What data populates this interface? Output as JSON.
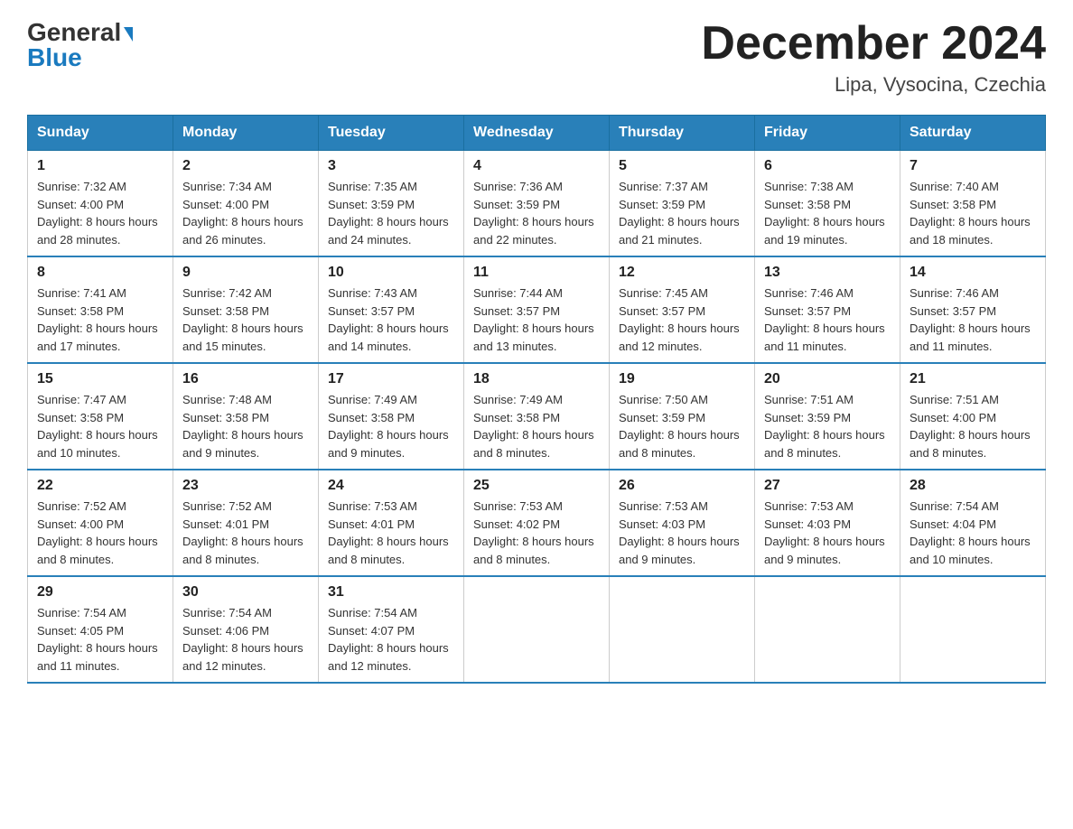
{
  "header": {
    "logo": {
      "general": "General",
      "blue": "Blue",
      "line1": "General",
      "line2": "Blue"
    },
    "title": "December 2024",
    "location": "Lipa, Vysocina, Czechia"
  },
  "calendar": {
    "headers": [
      "Sunday",
      "Monday",
      "Tuesday",
      "Wednesday",
      "Thursday",
      "Friday",
      "Saturday"
    ],
    "weeks": [
      [
        {
          "day": "1",
          "sunrise": "7:32 AM",
          "sunset": "4:00 PM",
          "daylight": "8 hours and 28 minutes."
        },
        {
          "day": "2",
          "sunrise": "7:34 AM",
          "sunset": "4:00 PM",
          "daylight": "8 hours and 26 minutes."
        },
        {
          "day": "3",
          "sunrise": "7:35 AM",
          "sunset": "3:59 PM",
          "daylight": "8 hours and 24 minutes."
        },
        {
          "day": "4",
          "sunrise": "7:36 AM",
          "sunset": "3:59 PM",
          "daylight": "8 hours and 22 minutes."
        },
        {
          "day": "5",
          "sunrise": "7:37 AM",
          "sunset": "3:59 PM",
          "daylight": "8 hours and 21 minutes."
        },
        {
          "day": "6",
          "sunrise": "7:38 AM",
          "sunset": "3:58 PM",
          "daylight": "8 hours and 19 minutes."
        },
        {
          "day": "7",
          "sunrise": "7:40 AM",
          "sunset": "3:58 PM",
          "daylight": "8 hours and 18 minutes."
        }
      ],
      [
        {
          "day": "8",
          "sunrise": "7:41 AM",
          "sunset": "3:58 PM",
          "daylight": "8 hours and 17 minutes."
        },
        {
          "day": "9",
          "sunrise": "7:42 AM",
          "sunset": "3:58 PM",
          "daylight": "8 hours and 15 minutes."
        },
        {
          "day": "10",
          "sunrise": "7:43 AM",
          "sunset": "3:57 PM",
          "daylight": "8 hours and 14 minutes."
        },
        {
          "day": "11",
          "sunrise": "7:44 AM",
          "sunset": "3:57 PM",
          "daylight": "8 hours and 13 minutes."
        },
        {
          "day": "12",
          "sunrise": "7:45 AM",
          "sunset": "3:57 PM",
          "daylight": "8 hours and 12 minutes."
        },
        {
          "day": "13",
          "sunrise": "7:46 AM",
          "sunset": "3:57 PM",
          "daylight": "8 hours and 11 minutes."
        },
        {
          "day": "14",
          "sunrise": "7:46 AM",
          "sunset": "3:57 PM",
          "daylight": "8 hours and 11 minutes."
        }
      ],
      [
        {
          "day": "15",
          "sunrise": "7:47 AM",
          "sunset": "3:58 PM",
          "daylight": "8 hours and 10 minutes."
        },
        {
          "day": "16",
          "sunrise": "7:48 AM",
          "sunset": "3:58 PM",
          "daylight": "8 hours and 9 minutes."
        },
        {
          "day": "17",
          "sunrise": "7:49 AM",
          "sunset": "3:58 PM",
          "daylight": "8 hours and 9 minutes."
        },
        {
          "day": "18",
          "sunrise": "7:49 AM",
          "sunset": "3:58 PM",
          "daylight": "8 hours and 8 minutes."
        },
        {
          "day": "19",
          "sunrise": "7:50 AM",
          "sunset": "3:59 PM",
          "daylight": "8 hours and 8 minutes."
        },
        {
          "day": "20",
          "sunrise": "7:51 AM",
          "sunset": "3:59 PM",
          "daylight": "8 hours and 8 minutes."
        },
        {
          "day": "21",
          "sunrise": "7:51 AM",
          "sunset": "4:00 PM",
          "daylight": "8 hours and 8 minutes."
        }
      ],
      [
        {
          "day": "22",
          "sunrise": "7:52 AM",
          "sunset": "4:00 PM",
          "daylight": "8 hours and 8 minutes."
        },
        {
          "day": "23",
          "sunrise": "7:52 AM",
          "sunset": "4:01 PM",
          "daylight": "8 hours and 8 minutes."
        },
        {
          "day": "24",
          "sunrise": "7:53 AM",
          "sunset": "4:01 PM",
          "daylight": "8 hours and 8 minutes."
        },
        {
          "day": "25",
          "sunrise": "7:53 AM",
          "sunset": "4:02 PM",
          "daylight": "8 hours and 8 minutes."
        },
        {
          "day": "26",
          "sunrise": "7:53 AM",
          "sunset": "4:03 PM",
          "daylight": "8 hours and 9 minutes."
        },
        {
          "day": "27",
          "sunrise": "7:53 AM",
          "sunset": "4:03 PM",
          "daylight": "8 hours and 9 minutes."
        },
        {
          "day": "28",
          "sunrise": "7:54 AM",
          "sunset": "4:04 PM",
          "daylight": "8 hours and 10 minutes."
        }
      ],
      [
        {
          "day": "29",
          "sunrise": "7:54 AM",
          "sunset": "4:05 PM",
          "daylight": "8 hours and 11 minutes."
        },
        {
          "day": "30",
          "sunrise": "7:54 AM",
          "sunset": "4:06 PM",
          "daylight": "8 hours and 12 minutes."
        },
        {
          "day": "31",
          "sunrise": "7:54 AM",
          "sunset": "4:07 PM",
          "daylight": "8 hours and 12 minutes."
        },
        null,
        null,
        null,
        null
      ]
    ]
  }
}
